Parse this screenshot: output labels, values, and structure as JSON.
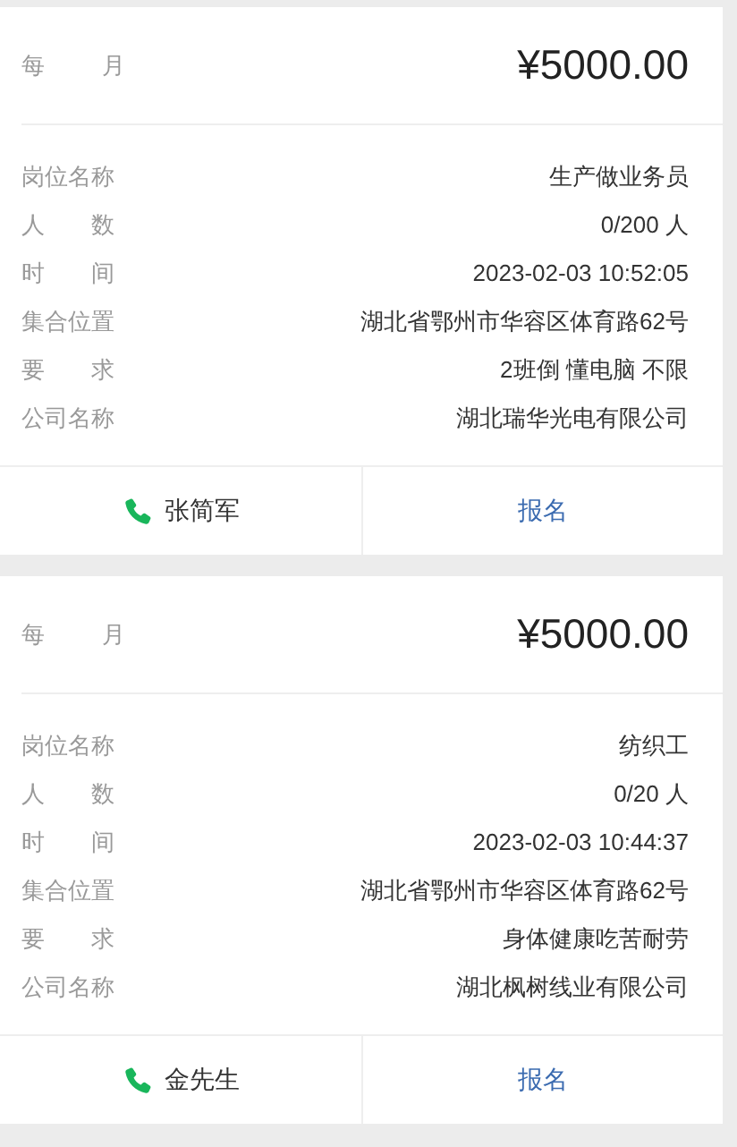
{
  "jobs": [
    {
      "salary_label": "每 月",
      "salary": "¥5000.00",
      "fields": [
        {
          "label": "岗位名称",
          "value": "生产做业务员"
        },
        {
          "label": "人 数",
          "value": "0/200 人"
        },
        {
          "label": "时 间",
          "value": "2023-02-03 10:52:05"
        },
        {
          "label": "集合位置",
          "value": "湖北省鄂州市华容区体育路62号"
        },
        {
          "label": "要 求",
          "value": "2班倒 懂电脑 不限"
        },
        {
          "label": "公司名称",
          "value": "湖北瑞华光电有限公司"
        }
      ],
      "contact": "张简军",
      "action": "报名"
    },
    {
      "salary_label": "每 月",
      "salary": "¥5000.00",
      "fields": [
        {
          "label": "岗位名称",
          "value": "纺织工"
        },
        {
          "label": "人 数",
          "value": "0/20 人"
        },
        {
          "label": "时 间",
          "value": "2023-02-03 10:44:37"
        },
        {
          "label": "集合位置",
          "value": "湖北省鄂州市华容区体育路62号"
        },
        {
          "label": "要 求",
          "value": "身体健康吃苦耐劳"
        },
        {
          "label": "公司名称",
          "value": "湖北枫树线业有限公司"
        }
      ],
      "contact": "金先生",
      "action": "报名"
    }
  ]
}
